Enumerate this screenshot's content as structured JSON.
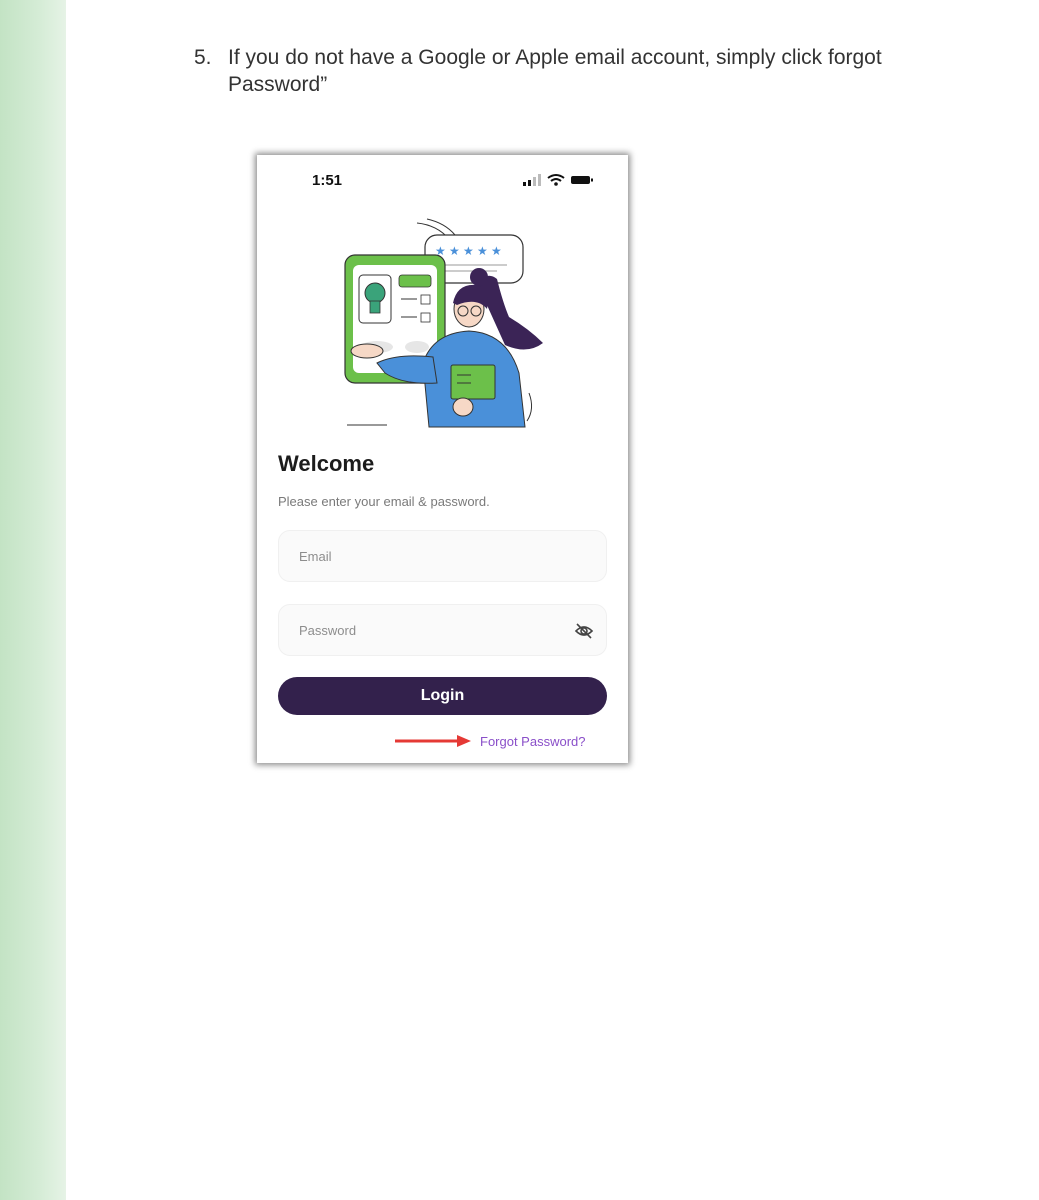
{
  "instruction": {
    "number": "5.",
    "text": "If you do not have a Google or Apple email account, simply click forgot Password”"
  },
  "phone": {
    "status_time": "1:51",
    "status_icons": [
      "signal-icon",
      "wifi-icon",
      "battery-icon"
    ],
    "welcome_title": "Welcome",
    "subtitle": "Please enter your email & password.",
    "email_placeholder": "Email",
    "password_placeholder": "Password",
    "password_visibility_icon": "eye-off-icon",
    "login_label": "Login",
    "forgot_label": "Forgot Password?",
    "colors": {
      "button": "#33214c",
      "link": "#8a4fc9",
      "arrow": "#e53935",
      "illustration_green": "#6cc04a",
      "illustration_blue": "#4a90d9",
      "illustration_purple": "#3b2456"
    }
  }
}
